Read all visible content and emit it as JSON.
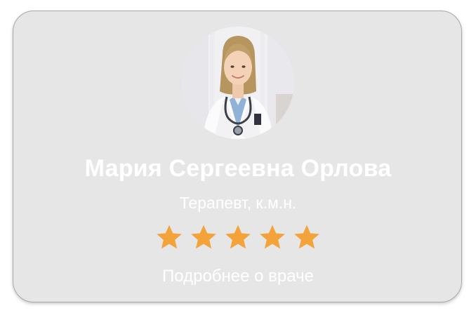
{
  "doctor": {
    "name": "Мария Сергеевна Орлова",
    "specialty": "Терапевт, к.м.н.",
    "rating": 5,
    "rating_max": 5,
    "avatar_icon": "doctor-photo",
    "more_link": "Подробнее о враче"
  },
  "colors": {
    "card_background": "#e6e6e6",
    "text": "#ffffff",
    "star": "#f3a33a"
  }
}
